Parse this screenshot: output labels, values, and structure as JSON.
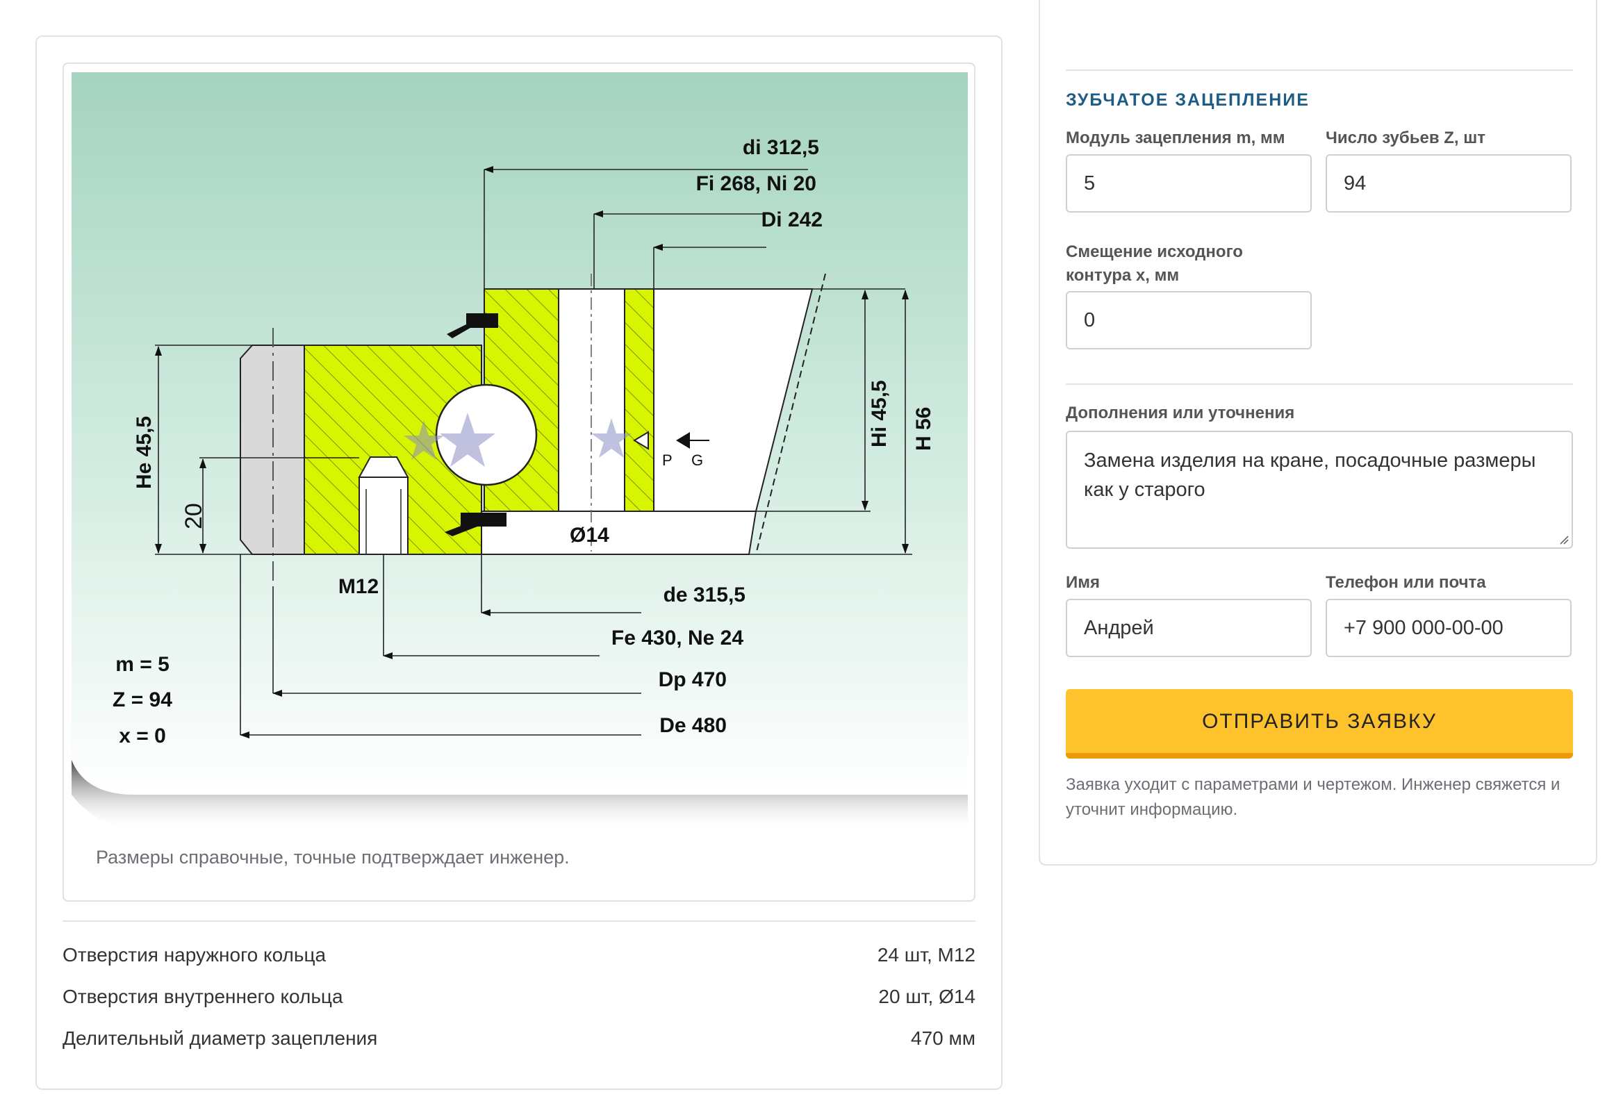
{
  "drawing": {
    "labels": {
      "di": "di 312,5",
      "fi_ni": "Fi 268, Ni 20",
      "di_small": "Di 242",
      "he": "He 45,5",
      "hi": "Hi 45,5",
      "h": "H 56",
      "twenty": "20",
      "p": "P",
      "g": "G",
      "hole": "Ø14",
      "m12": "M12",
      "de": "de 315,5",
      "fe_ne": "Fe 430, Ne 24",
      "dp": "Dp 470",
      "de_big": "De 480",
      "m": "m = 5",
      "z": "Z = 94",
      "x": "x = 0"
    },
    "caption": "Размеры справочные, точные подтверждает инженер.",
    "colors": {
      "lime": "#d7f500",
      "bg_top": "#a5d4c0",
      "bg_bottom": "#ffffff"
    }
  },
  "specs": [
    {
      "label": "Отверстия наружного кольца",
      "value": "24 шт, M12"
    },
    {
      "label": "Отверстия внутреннего кольца",
      "value": "20 шт, Ø14"
    },
    {
      "label": "Делительный диаметр зацепления",
      "value": "470 мм"
    }
  ],
  "form": {
    "section_title": "ЗУБЧАТОЕ ЗАЦЕПЛЕНИЕ",
    "module_label": "Модуль зацепления m, мм",
    "module_value": "5",
    "teeth_label": "Число зубьев Z, шт",
    "teeth_value": "94",
    "offset_label_1": "Смещение исходного",
    "offset_label_2": "контура x, мм",
    "offset_value": "0",
    "notes_label": "Дополнения или уточнения",
    "notes_value": "Замена изделия на кране, посадочные размеры как у старого",
    "name_label": "Имя",
    "name_value": "Андрей",
    "contact_label": "Телефон или почта",
    "contact_value": "+7 900 000-00-00",
    "submit_label": "ОТПРАВИТЬ ЗАЯВКУ",
    "note": "Заявка уходит с параметрами и чертежом. Инженер свяжется и уточнит информацию.",
    "accent_color": "#fec22d"
  }
}
